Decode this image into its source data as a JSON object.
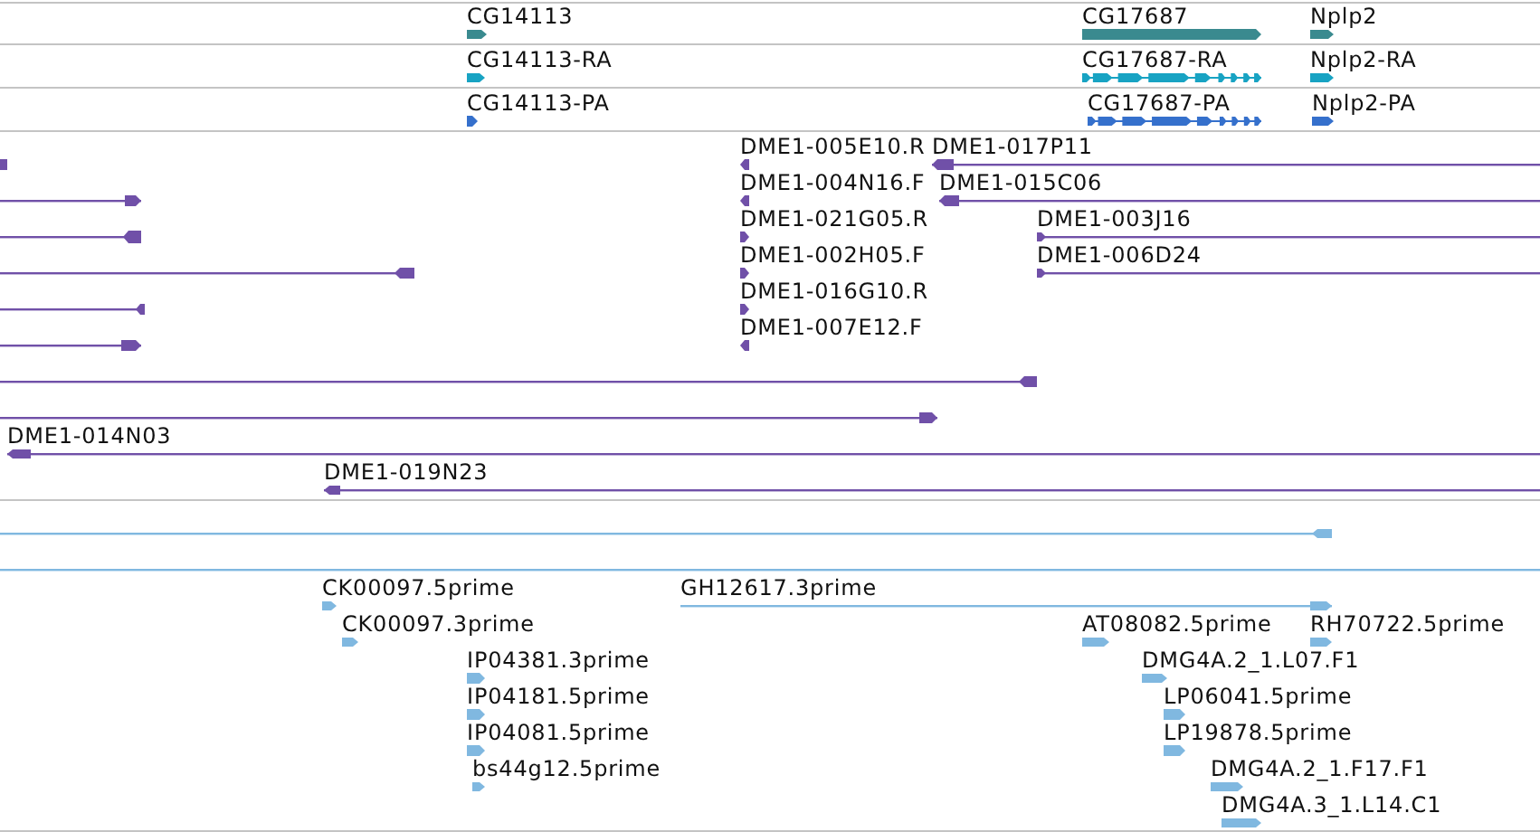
{
  "tracks": [
    {
      "kind": "gene",
      "color": "#3a8a8f",
      "features": [
        {
          "label": "CG14113",
          "kind": "block",
          "reverse": false
        },
        {
          "label": "CG17687",
          "kind": "bar",
          "reverse": false
        },
        {
          "label": "Nplp2",
          "kind": "block",
          "reverse": false
        }
      ]
    },
    {
      "kind": "transcript",
      "color": "#18a3c3",
      "features": [
        {
          "label": "CG14113-RA",
          "kind": "block",
          "reverse": false
        },
        {
          "label": "CG17687-RA",
          "kind": "exons",
          "reverse": false
        },
        {
          "label": "Nplp2-RA",
          "kind": "block",
          "reverse": false
        }
      ]
    },
    {
      "kind": "protein",
      "color": "#3570cc",
      "features": [
        {
          "label": "CG14113-PA",
          "kind": "block",
          "reverse": false
        },
        {
          "label": "CG17687-PA",
          "kind": "exons",
          "reverse": false
        },
        {
          "label": "Nplp2-PA",
          "kind": "block",
          "reverse": false
        }
      ]
    },
    {
      "kind": "clone",
      "color": "#7050a8",
      "features": [
        {
          "kind": "stub"
        },
        {
          "label": "DME1-005E10.R",
          "kind": "block",
          "reverse": true
        },
        {
          "label": "DME1-017P11",
          "kind": "line",
          "reverse": true
        },
        {
          "kind": "line",
          "reverse": false
        },
        {
          "label": "DME1-004N16.F",
          "kind": "block",
          "reverse": true
        },
        {
          "label": "DME1-015C06",
          "kind": "line",
          "reverse": true
        },
        {
          "kind": "line",
          "reverse": true
        },
        {
          "label": "DME1-021G05.R",
          "kind": "block",
          "reverse": false
        },
        {
          "label": "DME1-003J16",
          "kind": "line",
          "reverse": false
        },
        {
          "kind": "line",
          "reverse": true
        },
        {
          "label": "DME1-002H05.F",
          "kind": "block",
          "reverse": false
        },
        {
          "label": "DME1-006D24",
          "kind": "line",
          "reverse": false
        },
        {
          "kind": "line",
          "reverse": true
        },
        {
          "label": "DME1-016G10.R",
          "kind": "block",
          "reverse": false
        },
        {
          "kind": "line",
          "reverse": false
        },
        {
          "label": "DME1-007E12.F",
          "kind": "block",
          "reverse": true
        },
        {
          "kind": "line",
          "reverse": true
        },
        {
          "kind": "line",
          "reverse": false
        },
        {
          "label": "DME1-014N03",
          "kind": "line",
          "reverse": true
        },
        {
          "label": "DME1-019N23",
          "kind": "line",
          "reverse": true
        }
      ]
    },
    {
      "kind": "est",
      "color": "#80b8e0",
      "features": [
        {
          "kind": "line",
          "reverse": true
        },
        {
          "kind": "span"
        },
        {
          "label": "CK00097.5prime",
          "kind": "block",
          "reverse": false
        },
        {
          "label": "GH12617.3prime",
          "kind": "line",
          "reverse": false
        },
        {
          "label": "CK00097.3prime",
          "kind": "block",
          "reverse": false
        },
        {
          "label": "AT08082.5prime",
          "kind": "block",
          "reverse": false
        },
        {
          "label": "RH70722.5prime",
          "kind": "block",
          "reverse": false
        },
        {
          "label": "IP04381.3prime",
          "kind": "block",
          "reverse": false
        },
        {
          "label": "DMG4A.2_1.L07.F1",
          "kind": "block",
          "reverse": false
        },
        {
          "label": "IP04181.5prime",
          "kind": "block",
          "reverse": false
        },
        {
          "label": "LP06041.5prime",
          "kind": "block",
          "reverse": false
        },
        {
          "label": "IP04081.5prime",
          "kind": "block",
          "reverse": false
        },
        {
          "label": "LP19878.5prime",
          "kind": "block",
          "reverse": false
        },
        {
          "label": "bs44g12.5prime",
          "kind": "block",
          "reverse": false
        },
        {
          "label": "DMG4A.2_1.F17.F1",
          "kind": "block",
          "reverse": false
        },
        {
          "label": "DMG4A.3_1.L14.C1",
          "kind": "block",
          "reverse": false
        }
      ]
    }
  ]
}
